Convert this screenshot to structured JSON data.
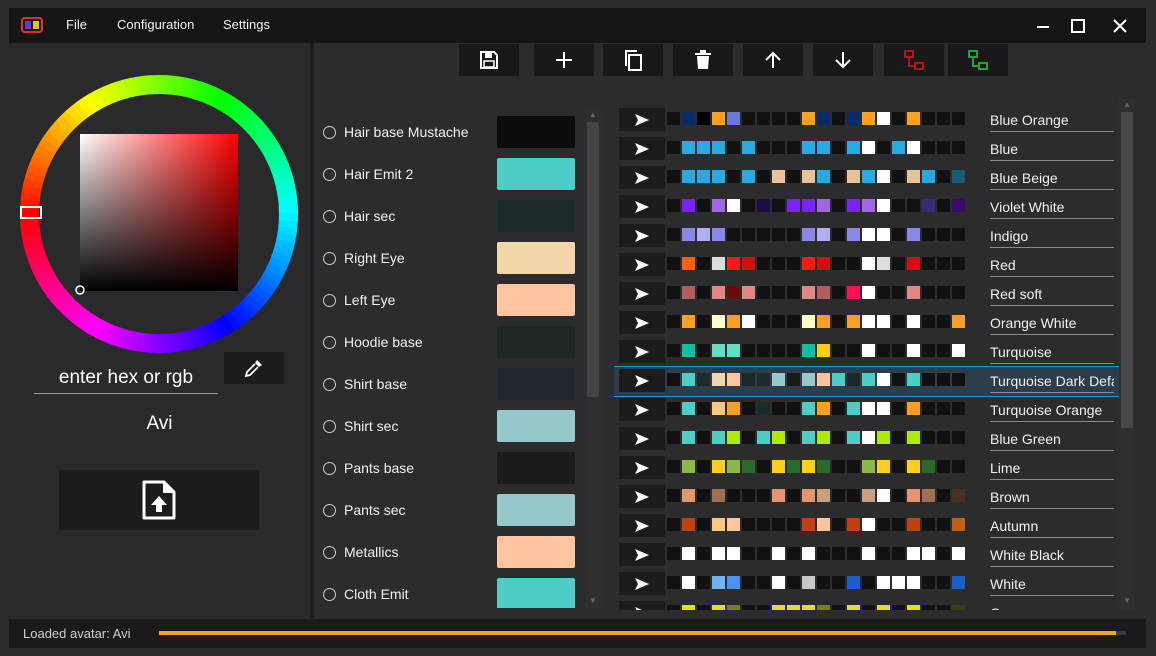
{
  "menu": {
    "file": "File",
    "configuration": "Configuration",
    "settings": "Settings"
  },
  "icons": {
    "logo": "app-logo",
    "minimize": "minimize-icon",
    "maximize": "maximize-icon",
    "close": "close-icon",
    "eyedropper": "eyedropper-icon",
    "upload": "file-upload-icon",
    "save": "save-icon",
    "add": "plus-icon",
    "copy": "copy-icon",
    "delete": "trash-icon",
    "up": "arrow-up-icon",
    "down": "arrow-down-icon",
    "send": "send-icon"
  },
  "colors": {
    "accent": "#f0a030",
    "selection": "#2f8fc2",
    "toolbar_red": "#b01818",
    "toolbar_green": "#1fa43c"
  },
  "color_picker": {
    "hex_placeholder": "enter hex or rgb",
    "selected_hue": "#ff0000"
  },
  "avatar": {
    "name": "Avi"
  },
  "toolbar": {
    "buttons": [
      "save",
      "add",
      "copy",
      "delete",
      "move-up",
      "move-down",
      "red-network",
      "green-network"
    ]
  },
  "slots": [
    {
      "label": "Hair base Mustache",
      "color": "#0c0c0c"
    },
    {
      "label": "Hair Emit 2",
      "color": "#4ecdc4"
    },
    {
      "label": "Hair sec",
      "color": "#1d2b2c"
    },
    {
      "label": "Right Eye",
      "color": "#f0d6a8"
    },
    {
      "label": "Left Eye",
      "color": "#ffc4a0"
    },
    {
      "label": "Hoodie base",
      "color": "#1c2828"
    },
    {
      "label": "Shirt base",
      "color": "#1e2a2d"
    },
    {
      "label": "Shirt sec",
      "color": "#97c8cc"
    },
    {
      "label": "Pants base",
      "color": "#1b1b1b"
    },
    {
      "label": "Pants sec",
      "color": "#97c8cc"
    },
    {
      "label": "Metallics",
      "color": "#ffc4a0"
    },
    {
      "label": "Cloth Emit",
      "color": "#4ecdc4"
    }
  ],
  "presets": [
    {
      "name": "Blue Orange",
      "colors": [
        "#111111",
        "#0a2a6a",
        "#000000",
        "#fca024",
        "#6a7ad6",
        "#111111",
        "#111111",
        "#111111",
        "#111111",
        "#fca024",
        "#0a2a6a",
        "#111111",
        "#0a2a6a",
        "#fca024",
        "#ffffff",
        "#111111",
        "#fca024",
        "#111111",
        "#111111",
        "#111111"
      ]
    },
    {
      "name": "Blue",
      "colors": [
        "#111111",
        "#29abe2",
        "#29abe2",
        "#29abe2",
        "#111111",
        "#29abe2",
        "#111111",
        "#111111",
        "#111111",
        "#29abe2",
        "#29abe2",
        "#111111",
        "#29abe2",
        "#ffffff",
        "#111111",
        "#29abe2",
        "#ffffff",
        "#111111",
        "#111111",
        "#111111"
      ]
    },
    {
      "name": "Blue Beige",
      "colors": [
        "#111111",
        "#29abe2",
        "#29abe2",
        "#29abe2",
        "#111111",
        "#29abe2",
        "#111111",
        "#e8c29a",
        "#111111",
        "#e8c29a",
        "#29abe2",
        "#111111",
        "#e8c29a",
        "#29abe2",
        "#ffffff",
        "#111111",
        "#e8c29a",
        "#29abe2",
        "#111111",
        "#135d75"
      ]
    },
    {
      "name": "Violet White",
      "colors": [
        "#111111",
        "#7a22ff",
        "#111111",
        "#a066e8",
        "#ffffff",
        "#111111",
        "#1d0c45",
        "#111111",
        "#7a22ff",
        "#7a22ff",
        "#a066e8",
        "#111111",
        "#7a22ff",
        "#a066e8",
        "#ffffff",
        "#111111",
        "#111111",
        "#3a2a7a",
        "#111111",
        "#3a0a6a"
      ]
    },
    {
      "name": "Indigo",
      "colors": [
        "#111111",
        "#8a8ae6",
        "#b0b0f0",
        "#8a8ae6",
        "#111111",
        "#111111",
        "#111111",
        "#111111",
        "#111111",
        "#8a8ae6",
        "#b0b0f0",
        "#111111",
        "#8a8ae6",
        "#ffffff",
        "#ffffff",
        "#111111",
        "#8a8ae6",
        "#111111",
        "#111111",
        "#111111"
      ]
    },
    {
      "name": "Red",
      "colors": [
        "#111111",
        "#ff6010",
        "#111111",
        "#dedede",
        "#ff1818",
        "#d01010",
        "#111111",
        "#111111",
        "#111111",
        "#ff1818",
        "#d01010",
        "#111111",
        "#111111",
        "#ffffff",
        "#dedede",
        "#111111",
        "#d01010",
        "#111111",
        "#111111",
        "#111111"
      ]
    },
    {
      "name": "Red soft",
      "colors": [
        "#111111",
        "#b25e60",
        "#111111",
        "#e38686",
        "#6a0a0a",
        "#e38686",
        "#111111",
        "#111111",
        "#111111",
        "#e38686",
        "#b25e60",
        "#111111",
        "#ff1050",
        "#ffffff",
        "#111111",
        "#111111",
        "#e38686",
        "#111111",
        "#111111",
        "#111111"
      ]
    },
    {
      "name": "Orange White",
      "colors": [
        "#111111",
        "#fca024",
        "#111111",
        "#ffffc8",
        "#fca024",
        "#ffffff",
        "#111111",
        "#111111",
        "#111111",
        "#ffffc8",
        "#fca024",
        "#111111",
        "#fca024",
        "#ffffff",
        "#ffffff",
        "#111111",
        "#ffffff",
        "#111111",
        "#111111",
        "#fca024"
      ]
    },
    {
      "name": "Turquoise",
      "colors": [
        "#111111",
        "#10c0a0",
        "#111111",
        "#68dcc2",
        "#68dcc2",
        "#111111",
        "#111111",
        "#111111",
        "#111111",
        "#10c0a0",
        "#ffce10",
        "#111111",
        "#111111",
        "#ffffff",
        "#111111",
        "#111111",
        "#ffffff",
        "#111111",
        "#111111",
        "#ffffff"
      ]
    },
    {
      "name": "Turquoise Dark Default",
      "colors": [
        "#111111",
        "#4ecdc4",
        "#1d2b2c",
        "#f0d6a8",
        "#ffc4a0",
        "#1c2828",
        "#1e2a2d",
        "#97c8cc",
        "#1b1b1b",
        "#97c8cc",
        "#ffc4a0",
        "#4ecdc4",
        "#1c2828",
        "#4ecdc4",
        "#ffffff",
        "#111111",
        "#4ecdc4",
        "#111111",
        "#111111",
        "#111111"
      ]
    },
    {
      "name": "Turquoise Orange",
      "colors": [
        "#111111",
        "#4ecdc4",
        "#111111",
        "#fcc880",
        "#fca024",
        "#111111",
        "#1d2b2c",
        "#111111",
        "#111111",
        "#4ecdc4",
        "#fca024",
        "#111111",
        "#4ecdc4",
        "#ffffff",
        "#ffffff",
        "#111111",
        "#fca024",
        "#111111",
        "#111111",
        "#111111"
      ]
    },
    {
      "name": "Blue Green",
      "colors": [
        "#111111",
        "#4ecdc4",
        "#111111",
        "#4ecdc4",
        "#aeea00",
        "#111111",
        "#4ecdc4",
        "#aeea00",
        "#111111",
        "#4ecdc4",
        "#aeea00",
        "#111111",
        "#4ecdc4",
        "#ffffff",
        "#aeea00",
        "#111111",
        "#aeea00",
        "#111111",
        "#111111",
        "#111111"
      ]
    },
    {
      "name": "Lime",
      "colors": [
        "#111111",
        "#8ab84a",
        "#111111",
        "#ffce20",
        "#8ab84a",
        "#2c6a2c",
        "#111111",
        "#ffce20",
        "#2c6a2c",
        "#ffce20",
        "#2c6a2c",
        "#111111",
        "#111111",
        "#8ab84a",
        "#ffce20",
        "#111111",
        "#ffce20",
        "#2c6a2c",
        "#111111",
        "#111111"
      ]
    },
    {
      "name": "Brown",
      "colors": [
        "#111111",
        "#e39470",
        "#111111",
        "#a07050",
        "#111111",
        "#111111",
        "#111111",
        "#e39470",
        "#111111",
        "#e39470",
        "#c8a080",
        "#111111",
        "#111111",
        "#c8a080",
        "#ffffff",
        "#111111",
        "#e39470",
        "#a07050",
        "#111111",
        "#4a3020"
      ]
    },
    {
      "name": "Autumn",
      "colors": [
        "#111111",
        "#c04010",
        "#111111",
        "#fcc880",
        "#ffc4a0",
        "#111111",
        "#111111",
        "#111111",
        "#111111",
        "#c04010",
        "#ffc4a0",
        "#111111",
        "#c04010",
        "#ffffff",
        "#111111",
        "#111111",
        "#c04010",
        "#111111",
        "#111111",
        "#c06010"
      ]
    },
    {
      "name": "White Black",
      "colors": [
        "#111111",
        "#ffffff",
        "#111111",
        "#ffffff",
        "#ffffff",
        "#111111",
        "#111111",
        "#ffffff",
        "#111111",
        "#ffffff",
        "#111111",
        "#111111",
        "#111111",
        "#ffffff",
        "#111111",
        "#111111",
        "#ffffff",
        "#ffffff",
        "#111111",
        "#ffffff"
      ]
    },
    {
      "name": "White",
      "colors": [
        "#111111",
        "#ffffff",
        "#111111",
        "#6fb5f5",
        "#4c90f0",
        "#111111",
        "#111111",
        "#ffffff",
        "#111111",
        "#c8c8c8",
        "#111111",
        "#111111",
        "#1a5ecb",
        "#111111",
        "#ffffff",
        "#ffffff",
        "#ffffff",
        "#111111",
        "#111111",
        "#1a5ecb"
      ]
    },
    {
      "name": "Green",
      "colors": [
        "#111111",
        "#dfe020",
        "#111111",
        "#dfe020",
        "#7a8010",
        "#111111",
        "#111111",
        "#dfe020",
        "#dfe020",
        "#dfe020",
        "#7a8010",
        "#111111",
        "#dfe020",
        "#111111",
        "#dfe020",
        "#111111",
        "#dfe020",
        "#111111",
        "#111111",
        "#3a4010"
      ]
    }
  ],
  "selected_preset": 9,
  "status": {
    "text": "Loaded avatar: Avi",
    "progress": 0.99
  }
}
